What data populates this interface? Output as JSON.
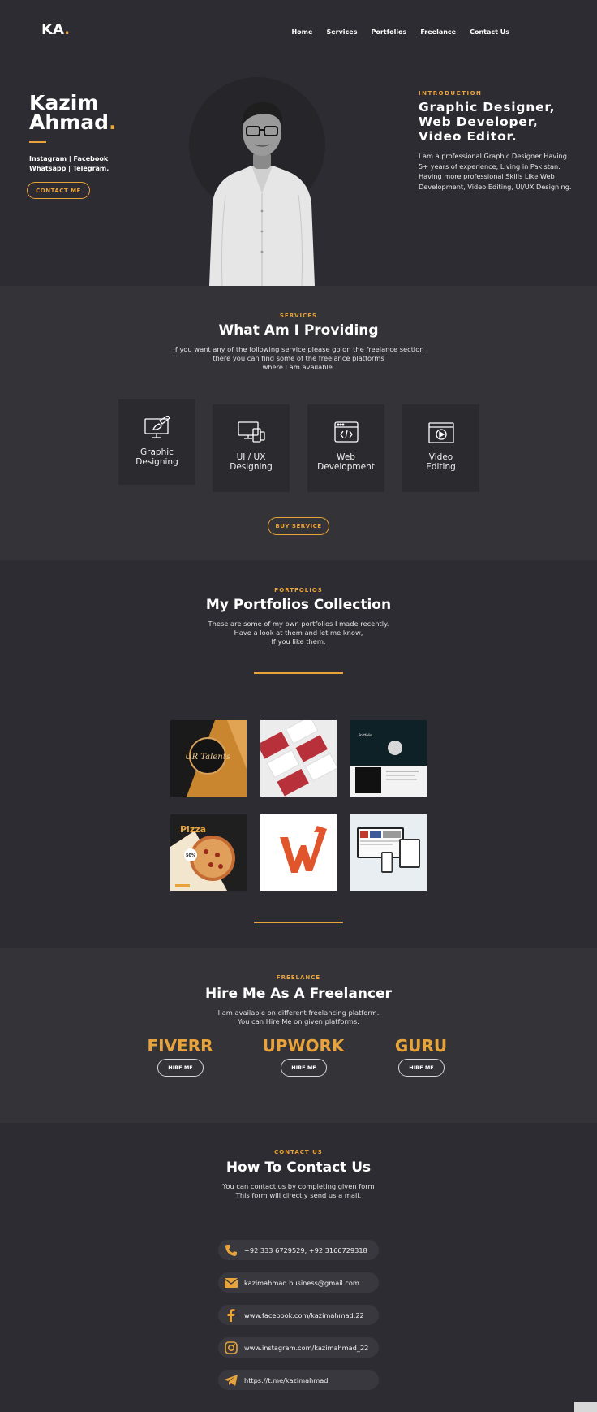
{
  "header": {
    "logo_text": "KA",
    "logo_dot": ".",
    "nav": [
      "Home",
      "Services",
      "Portfolios",
      "Freelance",
      "Contact Us"
    ]
  },
  "hero": {
    "name_line1": "Kazim",
    "name_line2": "Ahmad",
    "name_dot": ".",
    "social_line1": "Instagram | Facebook",
    "social_line2": "Whatsapp | Telegram.",
    "contact_button": "CONTACT ME",
    "intro_kicker": "INTRODUCTION",
    "intro_title_line1": "Graphic Designer,",
    "intro_title_line2": "Web Developer,",
    "intro_title_line3": "Video Editor.",
    "intro_text": "I am a professional Graphic Designer Having 5+ years of experience, Living in Pakistan. Having more professional Skills Like Web Development, Video Editing, UI/UX Designing."
  },
  "services": {
    "kicker": "SERVICES",
    "title": "What Am I Providing",
    "sub_line1": "If you want any of the following service please go on the freelance section",
    "sub_line2": "there you can find some of the freelance platforms",
    "sub_line3": "where I am available.",
    "cards": [
      {
        "label1": "Graphic",
        "label2": "Designing",
        "icon": "graphic-design-icon"
      },
      {
        "label1": "UI / UX",
        "label2": "Designing",
        "icon": "devices-icon"
      },
      {
        "label1": "Web",
        "label2": "Development",
        "icon": "code-window-icon"
      },
      {
        "label1": "Video",
        "label2": "Editing",
        "icon": "video-play-icon"
      }
    ],
    "buy_button": "BUY SERVICE"
  },
  "portfolio": {
    "kicker": "PORTFOLIOS",
    "title": "My Portfolios Collection",
    "sub_line1": "These are some of my own portfolios I made recently.",
    "sub_line2": "Have a look at them and let me know,",
    "sub_line3": "If you like them.",
    "thumb1_text": "UR Talents",
    "thumb3_text": "Portfolio",
    "thumb4_text1": "Pizza",
    "thumb4_text2": "50%"
  },
  "freelance": {
    "kicker": "FREELANCE",
    "title": "Hire Me As A Freelancer",
    "sub_line1": "I am available on different freelancing platform.",
    "sub_line2": "You can Hire Me on given platforms.",
    "platforms": [
      {
        "name": "FIVERR",
        "button": "HIRE ME"
      },
      {
        "name": "UPWORK",
        "button": "HIRE ME"
      },
      {
        "name": "GURU",
        "button": "HIRE ME"
      }
    ]
  },
  "contact": {
    "kicker": "CONTACT US",
    "title": "How To Contact Us",
    "sub_line1": "You can contact us by completing given form",
    "sub_line2": "This form will directly send us a mail.",
    "items": [
      {
        "icon": "phone-icon",
        "text": "+92 333 6729529, +92 3166729318"
      },
      {
        "icon": "mail-icon",
        "text": "kazimahmad.business@gmail.com"
      },
      {
        "icon": "facebook-icon",
        "text": "www.facebook.com/kazimahmad.22"
      },
      {
        "icon": "instagram-icon",
        "text": "www.instagram.com/kazimahmad_22"
      },
      {
        "icon": "telegram-icon",
        "text": "https://t.me/kazimahmad"
      }
    ]
  },
  "colors": {
    "accent": "#e8a33a",
    "bg_dark": "#2c2c32",
    "bg_section": "#333338"
  }
}
